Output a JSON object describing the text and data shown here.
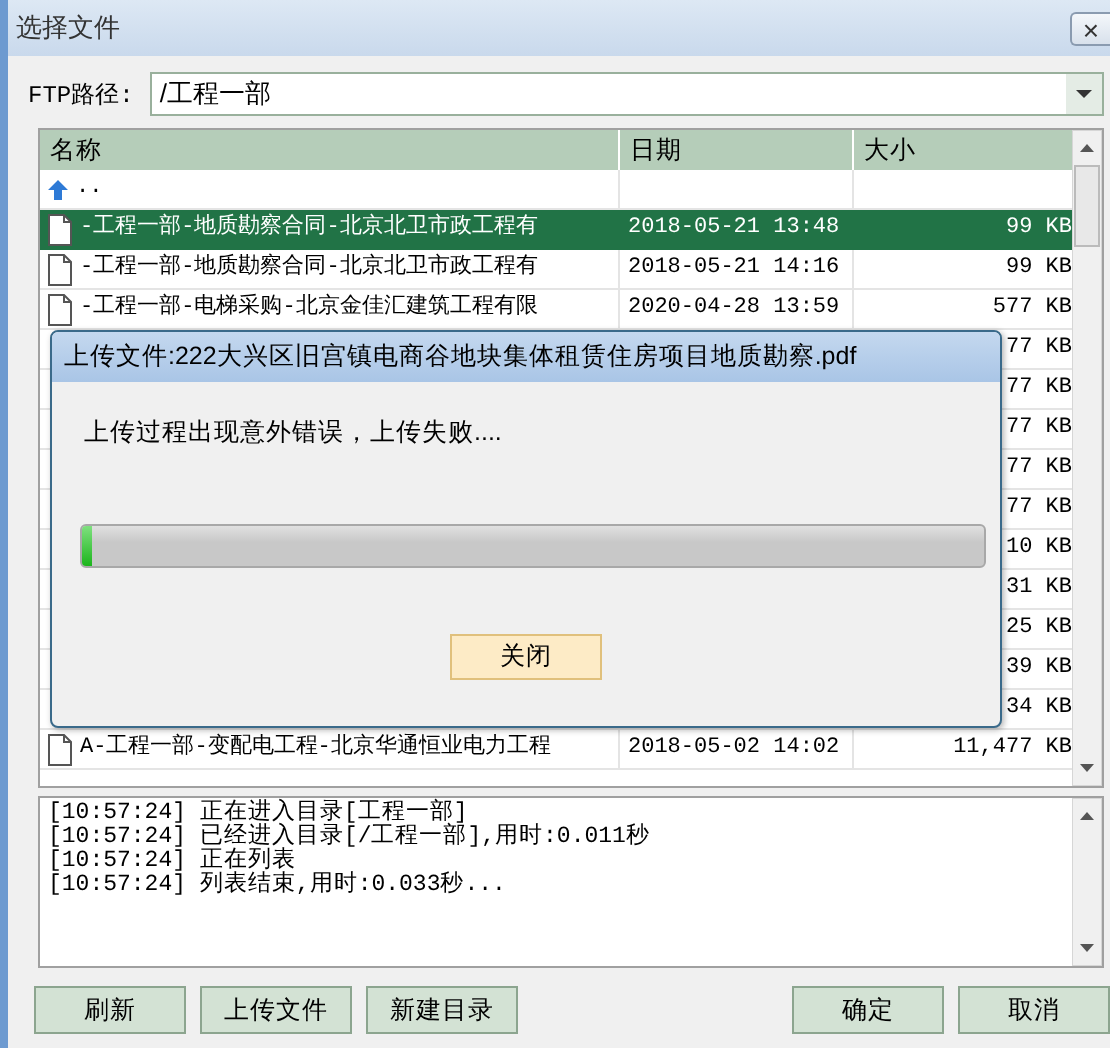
{
  "window": {
    "title": "选择文件",
    "close": "×"
  },
  "path": {
    "label": "FTP路径:",
    "value": "/工程一部"
  },
  "table": {
    "columns": [
      "名称",
      "日期",
      "大小"
    ],
    "rows": [
      {
        "kind": "up",
        "name": "..",
        "selected": false
      },
      {
        "kind": "file",
        "name": "-工程一部-地质勘察合同-北京北卫市政工程有",
        "date": "2018-05-21 13:48",
        "size": "99 KB",
        "selected": true
      },
      {
        "kind": "file",
        "name": "-工程一部-地质勘察合同-北京北卫市政工程有",
        "date": "2018-05-21 14:16",
        "size": "99 KB",
        "selected": false
      },
      {
        "kind": "file",
        "name": "-工程一部-电梯采购-北京金佳汇建筑工程有限",
        "date": "2020-04-28 13:59",
        "size": "577 KB",
        "selected": false
      },
      {
        "kind": "hidden",
        "size": "77 KB",
        "selected": false
      },
      {
        "kind": "hidden",
        "size": "77 KB",
        "selected": false
      },
      {
        "kind": "hidden",
        "size": "77 KB",
        "selected": false
      },
      {
        "kind": "hidden",
        "size": "77 KB",
        "selected": false
      },
      {
        "kind": "hidden",
        "size": "77 KB",
        "selected": false
      },
      {
        "kind": "hidden",
        "size": "10 KB",
        "selected": false
      },
      {
        "kind": "hidden",
        "size": "31 KB",
        "selected": false
      },
      {
        "kind": "hidden",
        "size": "25 KB",
        "selected": false
      },
      {
        "kind": "hidden",
        "size": "39 KB",
        "selected": false
      },
      {
        "kind": "hidden",
        "size": "34 KB",
        "selected": false
      },
      {
        "kind": "file",
        "name": "A-工程一部-变配电工程-北京华通恒业电力工程",
        "date": "2018-05-02 14:02",
        "size": "11,477 KB",
        "selected": false
      }
    ]
  },
  "upload_dialog": {
    "title": "上传文件:222大兴区旧宫镇电商谷地块集体租赁住房项目地质勘察.pdf",
    "message": "上传过程出现意外错误，上传失败....",
    "level": 0.01,
    "button": "关闭"
  },
  "log": [
    "[10:57:24] 正在进入目录[工程一部]",
    "[10:57:24] 已经进入目录[/工程一部],用时:0.011秒",
    "[10:57:24] 正在列表",
    "[10:57:24] 列表结束,用时:0.033秒..."
  ],
  "buttons_left": [
    "刷新",
    "上传文件",
    "新建目录"
  ],
  "buttons_right": [
    "确定",
    "取消"
  ]
}
